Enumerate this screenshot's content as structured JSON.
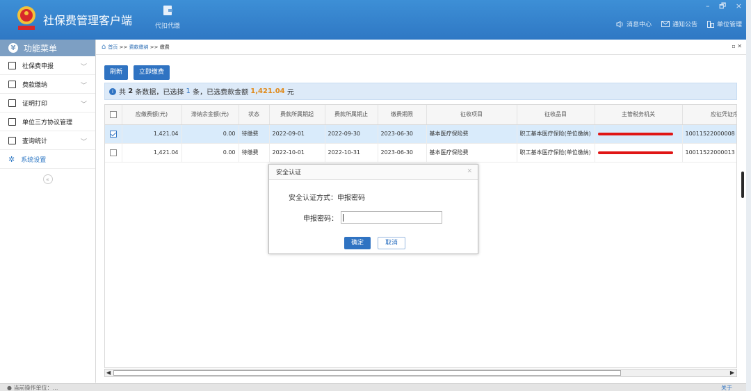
{
  "app": {
    "title": "社保费管理客户端"
  },
  "header": {
    "tax_btn_label": "代扣代缴",
    "links": [
      {
        "label": "消息中心",
        "icon": "speaker-icon"
      },
      {
        "label": "通知公告",
        "icon": "mail-icon"
      },
      {
        "label": "单位管理",
        "icon": "building-icon"
      }
    ],
    "window_controls": [
      "–",
      "🗗",
      "×"
    ]
  },
  "sidebar": {
    "title": "功能菜单",
    "items": [
      {
        "label": "社保费申报",
        "icon": "declare-icon",
        "expandable": true
      },
      {
        "label": "费款缴纳",
        "icon": "payment-icon",
        "expandable": true
      },
      {
        "label": "证明打印",
        "icon": "print-icon",
        "expandable": true
      },
      {
        "label": "单位三方协议管理",
        "icon": "agreement-icon",
        "expandable": false
      },
      {
        "label": "查询统计",
        "icon": "stats-icon",
        "expandable": true
      },
      {
        "label": "系统设置",
        "icon": "gear-icon",
        "expandable": false
      }
    ],
    "collapse_symbol": "«"
  },
  "breadcrumb": {
    "home": "首页",
    "sep": ">>",
    "level1": "费款缴纳",
    "level2": "缴费"
  },
  "toolbar": {
    "refresh": "刷新",
    "pay_now": "立即缴费"
  },
  "info": {
    "prefix": "共",
    "total": "2",
    "mid1": "条数据，已选择",
    "selected": "1",
    "mid2": "条，已选费款金额",
    "amount": "1,421.04",
    "suffix": "元"
  },
  "table": {
    "columns": [
      "应缴费额(元)",
      "滞纳余金额(元)",
      "状态",
      "费款所属期起",
      "费款所属期止",
      "缴费期限",
      "征收项目",
      "征收品目",
      "主管税务机关",
      "应征凭证序号"
    ],
    "rows": [
      {
        "checked": true,
        "amount": "1,421.04",
        "late_fee": "0.00",
        "status": "待缴费",
        "start": "2022-09-01",
        "end": "2022-09-30",
        "deadline": "2023-06-30",
        "item": "基本医疗保险费",
        "category": "职工基本医疗保险(单位缴纳)",
        "serial": "10011522000008"
      },
      {
        "checked": false,
        "amount": "1,421.04",
        "late_fee": "0.00",
        "status": "待缴费",
        "start": "2022-10-01",
        "end": "2022-10-31",
        "deadline": "2023-06-30",
        "item": "基本医疗保险费",
        "category": "职工基本医疗保险(单位缴纳)",
        "serial": "10011522000013"
      }
    ]
  },
  "dialog": {
    "title": "安全认证",
    "method_label": "安全认证方式：",
    "method_value": "申报密码",
    "password_label": "申报密码：",
    "password_value": "",
    "ok": "确定",
    "cancel": "取消"
  },
  "status": {
    "left": "● 当前操作单位：…",
    "right": "关于"
  }
}
